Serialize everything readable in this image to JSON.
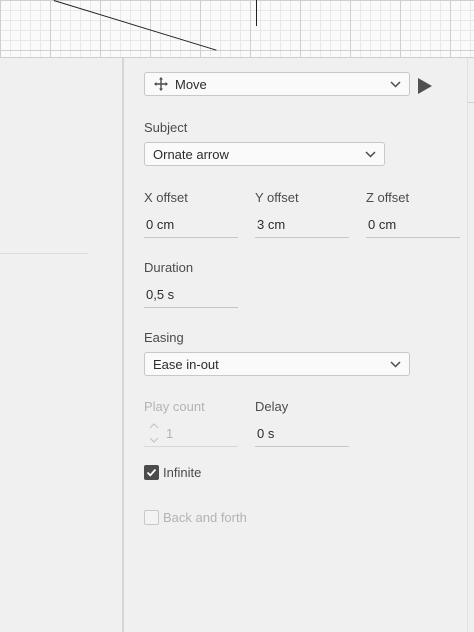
{
  "action": {
    "selected": "Move",
    "icon": "move-icon"
  },
  "subject": {
    "label": "Subject",
    "selected": "Ornate arrow"
  },
  "offsets": {
    "x": {
      "label": "X offset",
      "value": "0 cm"
    },
    "y": {
      "label": "Y offset",
      "value": "3 cm"
    },
    "z": {
      "label": "Z offset",
      "value": "0 cm"
    }
  },
  "duration": {
    "label": "Duration",
    "value": "0,5 s"
  },
  "easing": {
    "label": "Easing",
    "selected": "Ease in-out"
  },
  "play_count": {
    "label": "Play count",
    "value": "1"
  },
  "delay": {
    "label": "Delay",
    "value": "0 s"
  },
  "infinite": {
    "label": "Infinite",
    "checked": true
  },
  "back_and_forth": {
    "label": "Back and forth",
    "checked": false
  },
  "colors": {
    "panel_bg": "#f0f0f0",
    "field_bg": "#fafafa",
    "disabled_text": "#b3b3b3",
    "checkbox_on": "#4b4b4b"
  }
}
